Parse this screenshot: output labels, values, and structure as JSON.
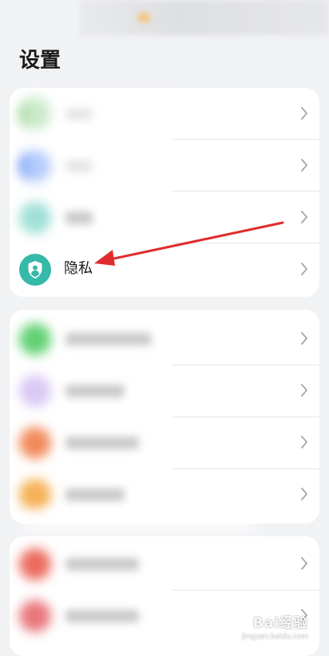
{
  "page_title": "设置",
  "groups": [
    {
      "items": [
        {
          "label": "",
          "blurred": true,
          "icon_color": "#8fd08a",
          "label_width": 34
        },
        {
          "label": "",
          "blurred": true,
          "icon_color": "#5a8cf5",
          "label_width": 34
        },
        {
          "label": "",
          "blurred": true,
          "icon_color": "#9fe0d6",
          "label_width": 34
        },
        {
          "label": "隐私",
          "blurred": false,
          "icon": "shield-person-icon",
          "icon_color": "#35b9a8"
        }
      ]
    },
    {
      "items": [
        {
          "label": "",
          "blurred": true,
          "icon_color": "#63d173",
          "label_width": 108
        },
        {
          "label": "",
          "blurred": true,
          "icon_color": "#d9c8f5",
          "label_width": 74
        },
        {
          "label": "",
          "blurred": true,
          "icon_color": "#f28a5b",
          "label_width": 92
        },
        {
          "label": "",
          "blurred": true,
          "icon_color": "#f5b156",
          "label_width": 74
        }
      ]
    },
    {
      "items": [
        {
          "label": "",
          "blurred": true,
          "icon_color": "#ec6b5e",
          "label_width": 92
        },
        {
          "label": "",
          "blurred": true,
          "icon_color": "#e8777c",
          "label_width": 92
        }
      ]
    }
  ],
  "annotation": {
    "type": "red-arrow",
    "color": "#e02c2c",
    "points_to": "隐私"
  },
  "watermark": {
    "text": "Bai经验",
    "sub": "jingyan.baidu.com"
  }
}
